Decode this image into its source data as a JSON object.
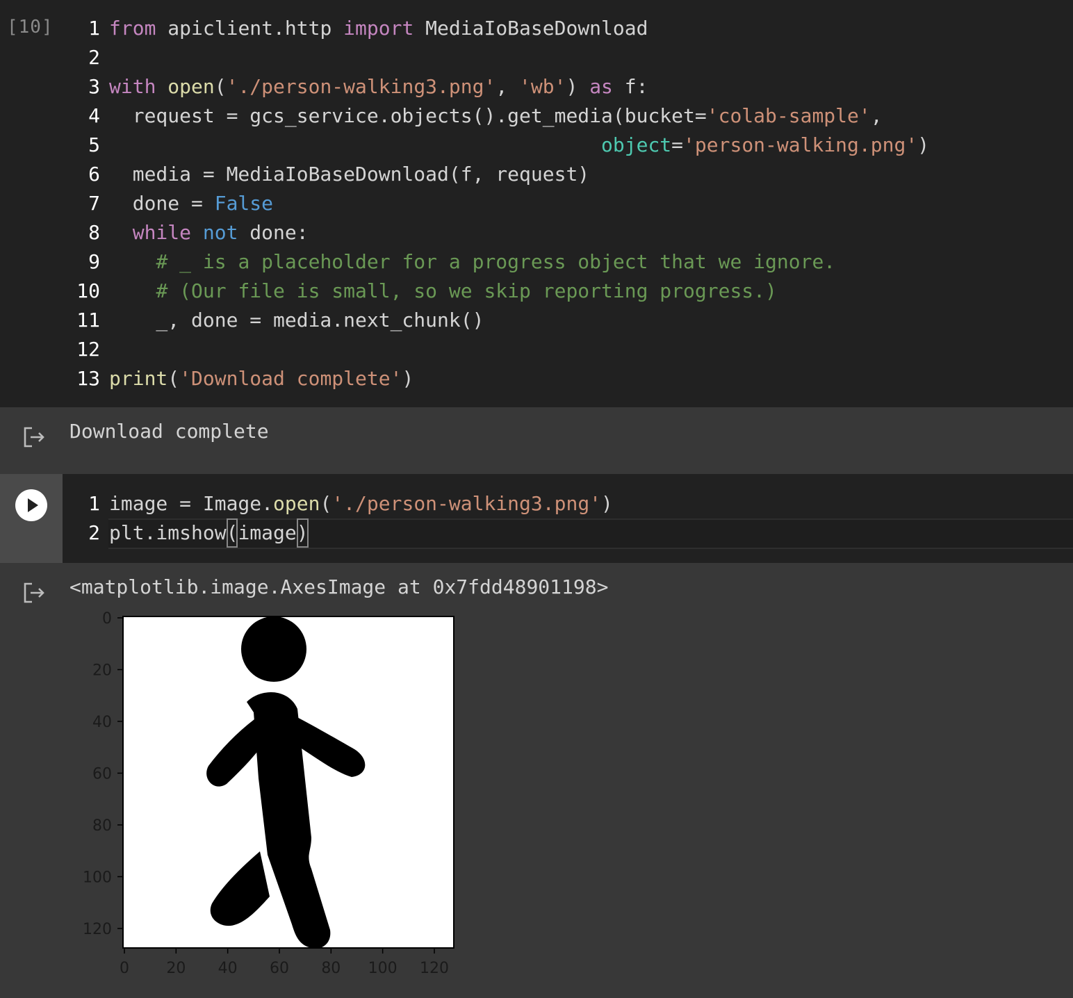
{
  "cell1": {
    "execution_count": "[10]",
    "lines": [
      {
        "n": "1",
        "tokens": [
          [
            "kw",
            "from"
          ],
          [
            "plain",
            " apiclient.http "
          ],
          [
            "kw",
            "import"
          ],
          [
            "plain",
            " MediaIoBaseDownload"
          ]
        ]
      },
      {
        "n": "2",
        "tokens": []
      },
      {
        "n": "3",
        "tokens": [
          [
            "kw",
            "with"
          ],
          [
            "plain",
            " "
          ],
          [
            "fn",
            "open"
          ],
          [
            "plain",
            "("
          ],
          [
            "str",
            "'./person-walking3.png'"
          ],
          [
            "plain",
            ", "
          ],
          [
            "str",
            "'wb'"
          ],
          [
            "plain",
            ") "
          ],
          [
            "kw",
            "as"
          ],
          [
            "plain",
            " f:"
          ]
        ]
      },
      {
        "n": "4",
        "tokens": [
          [
            "plain",
            "  request = gcs_service.objects().get_media(bucket="
          ],
          [
            "str",
            "'colab-sample'"
          ],
          [
            "plain",
            ","
          ]
        ]
      },
      {
        "n": "5",
        "tokens": [
          [
            "plain",
            "                                          "
          ],
          [
            "param",
            "object"
          ],
          [
            "plain",
            "="
          ],
          [
            "str",
            "'person-walking.png'"
          ],
          [
            "plain",
            ")"
          ]
        ]
      },
      {
        "n": "6",
        "tokens": [
          [
            "plain",
            "  media = MediaIoBaseDownload(f, request)"
          ]
        ]
      },
      {
        "n": "7",
        "tokens": [
          [
            "plain",
            "  done = "
          ],
          [
            "bool",
            "False"
          ]
        ]
      },
      {
        "n": "8",
        "tokens": [
          [
            "plain",
            "  "
          ],
          [
            "kw",
            "while"
          ],
          [
            "plain",
            " "
          ],
          [
            "bool",
            "not"
          ],
          [
            "plain",
            " done:"
          ]
        ]
      },
      {
        "n": "9",
        "tokens": [
          [
            "plain",
            "    "
          ],
          [
            "cmt",
            "# _ is a placeholder for a progress object that we ignore."
          ]
        ]
      },
      {
        "n": "10",
        "tokens": [
          [
            "plain",
            "    "
          ],
          [
            "cmt",
            "# (Our file is small, so we skip reporting progress.)"
          ]
        ]
      },
      {
        "n": "11",
        "tokens": [
          [
            "plain",
            "    _, done = media.next_chunk()"
          ]
        ]
      },
      {
        "n": "12",
        "tokens": []
      },
      {
        "n": "13",
        "tokens": [
          [
            "fn",
            "print"
          ],
          [
            "plain",
            "("
          ],
          [
            "str",
            "'Download complete'"
          ],
          [
            "plain",
            ")"
          ]
        ]
      }
    ]
  },
  "output1": {
    "icon": "output-redirect-icon",
    "text": "Download complete"
  },
  "cell2": {
    "run_icon": "play-icon",
    "lines": [
      {
        "n": "1",
        "tokens": [
          [
            "plain",
            "image = Image."
          ],
          [
            "fn",
            "open"
          ],
          [
            "plain",
            "("
          ],
          [
            "str",
            "'./person-walking3.png'"
          ],
          [
            "plain",
            ")"
          ]
        ]
      },
      {
        "n": "2",
        "tokens": [
          [
            "plain",
            "plt.imshow"
          ],
          [
            "bracket",
            "("
          ],
          [
            "plain",
            "image"
          ],
          [
            "bracket",
            ")"
          ]
        ]
      }
    ]
  },
  "output2": {
    "icon": "output-redirect-icon",
    "text": "<matplotlib.image.AxesImage at 0x7fdd48901198>"
  },
  "chart_data": {
    "type": "image",
    "content": "person-walking pictogram",
    "x_ticks": [
      "0",
      "20",
      "40",
      "60",
      "80",
      "100",
      "120"
    ],
    "y_ticks": [
      "0",
      "20",
      "40",
      "60",
      "80",
      "100",
      "120"
    ],
    "xlim": [
      0,
      127
    ],
    "ylim": [
      127,
      0
    ]
  },
  "colors": {
    "cell_bg": "#212121",
    "output_bg": "#383838",
    "keyword": "#c586c0",
    "function": "#dcdcaa",
    "string": "#ce9178",
    "comment": "#6a9955",
    "constant": "#569cd6",
    "param": "#4ec9b0"
  }
}
